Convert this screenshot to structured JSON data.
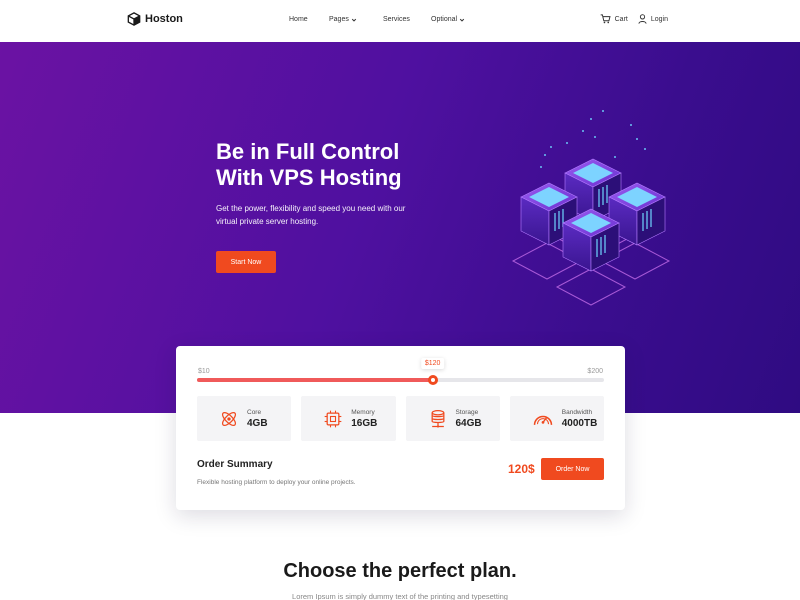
{
  "nav": {
    "brand": "Hoston",
    "links": [
      {
        "label": "Home",
        "dropdown": false
      },
      {
        "label": "Pages",
        "dropdown": true
      },
      {
        "label": "Services",
        "dropdown": false
      },
      {
        "label": "Optional",
        "dropdown": true
      }
    ],
    "cart_label": "Cart",
    "login_label": "Login"
  },
  "hero": {
    "title_line1": "Be in Full Control",
    "title_line2": "With VPS Hosting",
    "subtitle": "Get the power, flexibility and speed you need with our virtual private server hosting.",
    "cta_label": "Start Now"
  },
  "pricing": {
    "min_label": "$10",
    "max_label": "$200",
    "current_label": "$120",
    "slider_min": 10,
    "slider_max": 200,
    "slider_value": 120,
    "specs": [
      {
        "label": "Core",
        "value": "4GB",
        "icon": "atom-icon"
      },
      {
        "label": "Memory",
        "value": "16GB",
        "icon": "chip-icon"
      },
      {
        "label": "Storage",
        "value": "64GB",
        "icon": "database-icon"
      },
      {
        "label": "Bandwidth",
        "value": "4000TB",
        "icon": "speedometer-icon"
      }
    ],
    "summary_title": "Order Summary",
    "summary_desc": "Flexible hosting platform to deploy your online projects.",
    "price": "120$",
    "order_label": "Order Now"
  },
  "section": {
    "title": "Choose the perfect plan.",
    "subtitle": "Lorem Ipsum is simply dummy text of the printing and typesetting"
  },
  "colors": {
    "accent": "#f04a1f",
    "hero_start": "#6b12a3",
    "hero_end": "#2f0b82"
  }
}
